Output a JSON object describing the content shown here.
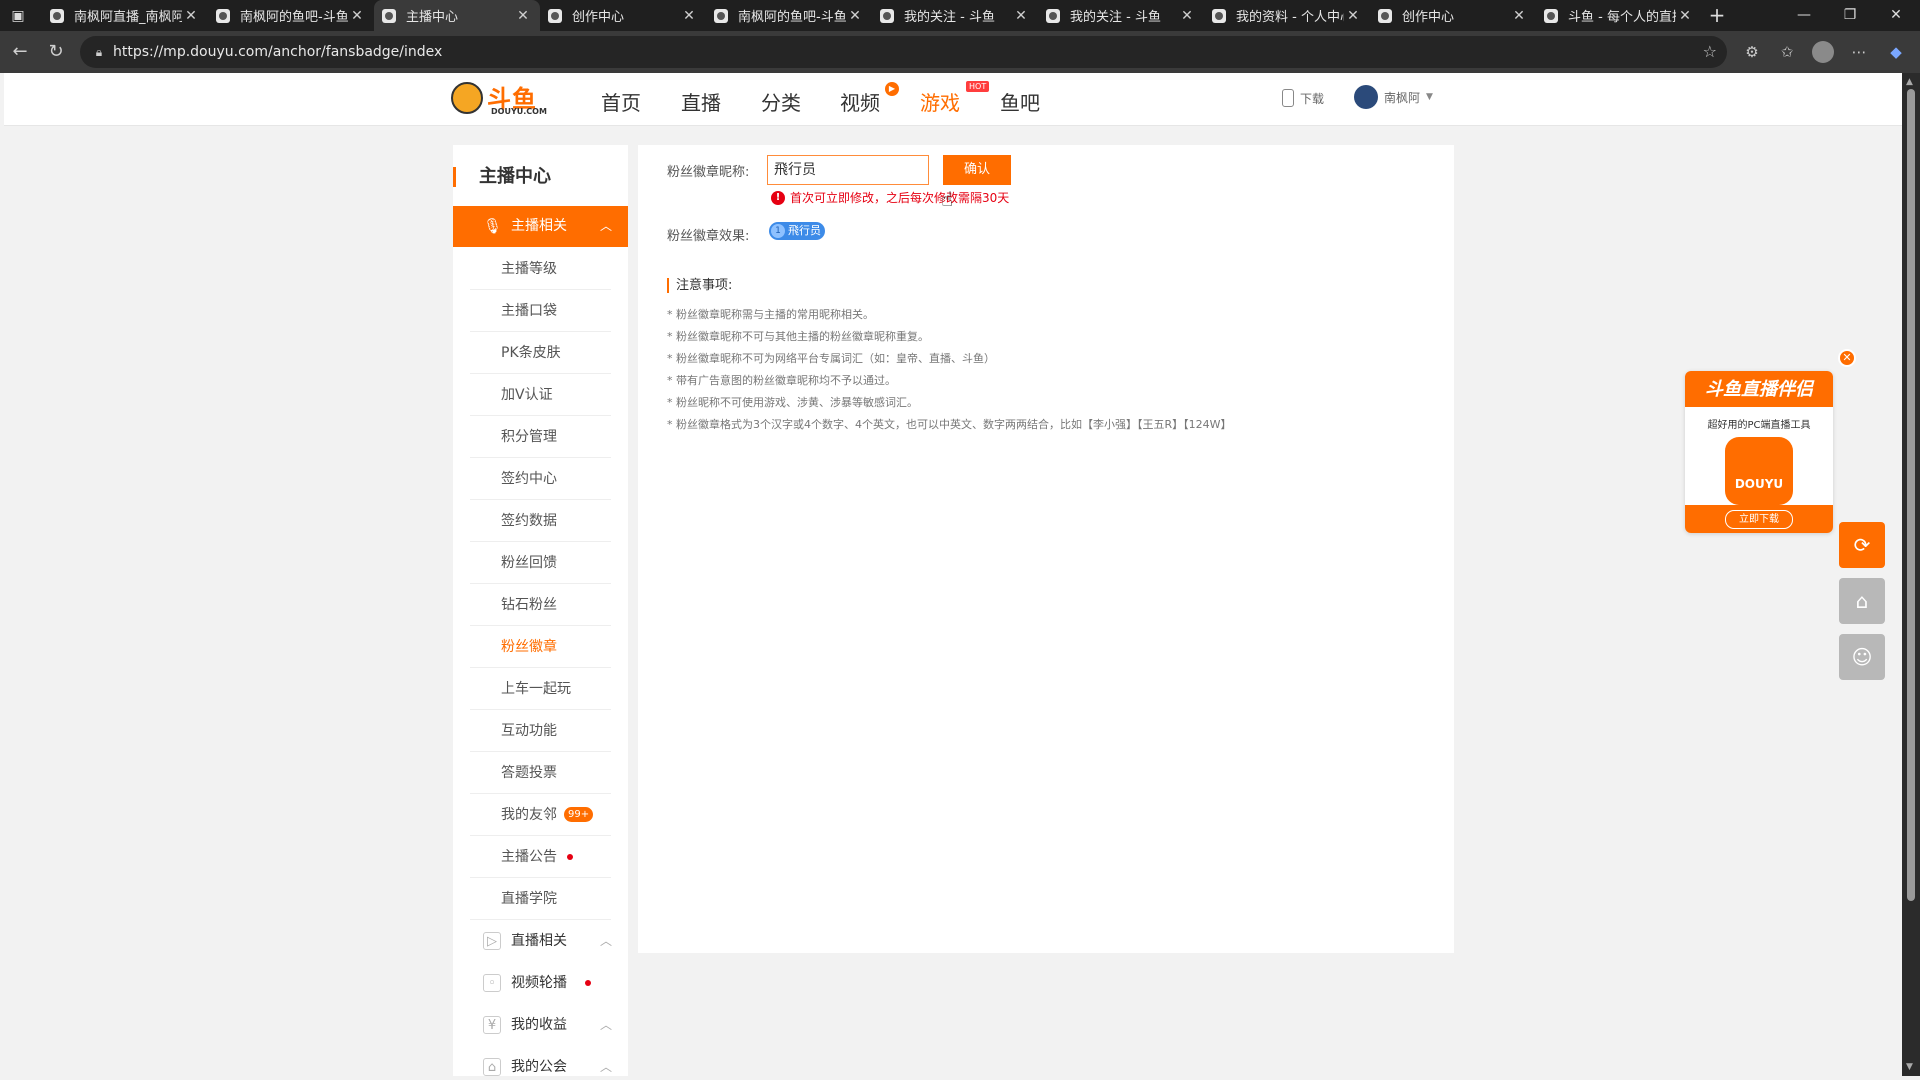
{
  "browser": {
    "tabs": [
      {
        "title": "南枫阿直播_南枫阿",
        "active": false
      },
      {
        "title": "南枫阿的鱼吧-斗鱼",
        "active": false
      },
      {
        "title": "主播中心",
        "active": true
      },
      {
        "title": "创作中心",
        "active": false
      },
      {
        "title": "南枫阿的鱼吧-斗鱼",
        "active": false
      },
      {
        "title": "我的关注 - 斗鱼",
        "active": false
      },
      {
        "title": "我的关注 - 斗鱼",
        "active": false
      },
      {
        "title": "我的资料 - 个人中心",
        "active": false
      },
      {
        "title": "创作中心",
        "active": false
      },
      {
        "title": "斗鱼 - 每个人的直播",
        "active": false
      }
    ],
    "url": "https://mp.douyu.com/anchor/fansbadge/index"
  },
  "header": {
    "logo_text": "斗鱼",
    "logo_sub": "DOUYU.COM",
    "nav": [
      "首页",
      "直播",
      "分类",
      "视频",
      "游戏",
      "鱼吧"
    ],
    "hot_badge": "HOT",
    "download": "下载",
    "username": "南枫阿"
  },
  "sidebar": {
    "title": "主播中心",
    "active_group": "主播相关",
    "items": [
      {
        "label": "主播等级"
      },
      {
        "label": "主播口袋"
      },
      {
        "label": "PK条皮肤"
      },
      {
        "label": "加V认证"
      },
      {
        "label": "积分管理"
      },
      {
        "label": "签约中心"
      },
      {
        "label": "签约数据"
      },
      {
        "label": "粉丝回馈"
      },
      {
        "label": "钻石粉丝"
      },
      {
        "label": "粉丝徽章"
      },
      {
        "label": "上车一起玩"
      },
      {
        "label": "互动功能"
      },
      {
        "label": "答题投票"
      },
      {
        "label": "我的友邻",
        "badge": "99+"
      },
      {
        "label": "主播公告"
      },
      {
        "label": "直播学院"
      }
    ],
    "groups": [
      {
        "label": "直播相关"
      },
      {
        "label": "视频轮播"
      },
      {
        "label": "我的收益"
      },
      {
        "label": "我的公会"
      }
    ]
  },
  "content": {
    "nick_label": "粉丝徽章昵称:",
    "nick_value": "飛行员",
    "confirm": "确认",
    "warning": "首次可立即修改，之后每次修改需隔30天",
    "effect_label": "粉丝徽章效果:",
    "badge_level": "1",
    "badge_text": "飛行员",
    "notes_title": "注意事项:",
    "notes": [
      "* 粉丝徽章昵称需与主播的常用昵称相关。",
      "* 粉丝徽章昵称不可与其他主播的粉丝徽章昵称重复。",
      "* 粉丝徽章昵称不可为网络平台专属词汇（如：皇帝、直播、斗鱼）",
      "* 带有广告意图的粉丝徽章昵称均不予以通过。",
      "* 粉丝昵称不可使用游戏、涉黄、涉暴等敏感词汇。",
      "* 粉丝徽章格式为3个汉字或4个数字、4个英文，也可以中英文、数字两两结合，比如【李小强】【王五R】【124W】"
    ]
  },
  "ad": {
    "title": "斗鱼直播伴侣",
    "subtitle": "超好用的PC端直播工具",
    "app_label": "DOUYU",
    "download": "立即下载"
  },
  "icons": {
    "mic": "mic-icon",
    "phone": "phone-icon",
    "warn": "warning-icon",
    "close": "close-icon"
  },
  "colors": {
    "accent": "#ff6d00",
    "error": "#e60012",
    "badge": "#3d8be8"
  }
}
